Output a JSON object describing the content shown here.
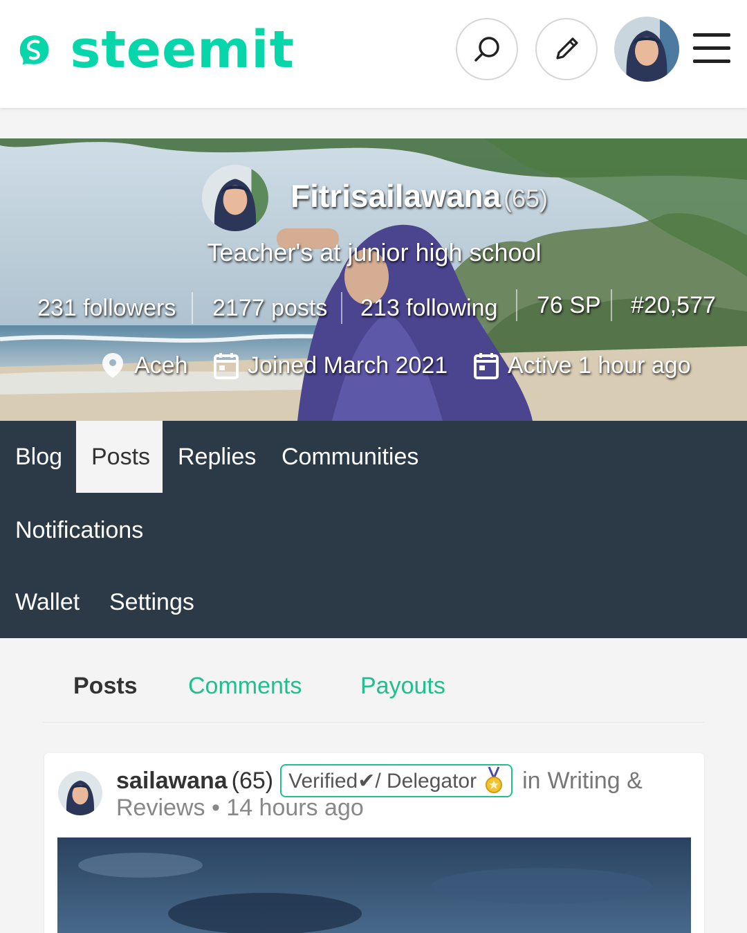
{
  "header": {
    "logo_text": "steemit",
    "brand_color": "#06d6a9",
    "icons": [
      "search-icon",
      "pencil-icon",
      "hamburger-menu-icon"
    ]
  },
  "profile": {
    "name": "Fitrisailawana",
    "reputation": "(65)",
    "about": "Teacher's at junior high school",
    "stats": {
      "followers": "231 followers",
      "posts": "2177 posts",
      "following": "213 following",
      "sp": "76 SP",
      "rank": "#20,577"
    },
    "location": "Aceh",
    "joined": "Joined March 2021",
    "active": "Active 1 hour ago"
  },
  "tabs": [
    {
      "label": "Blog"
    },
    {
      "label": "Posts",
      "active": true
    },
    {
      "label": "Replies"
    },
    {
      "label": "Communities"
    },
    {
      "label": "Notifications"
    },
    {
      "label": "Wallet"
    },
    {
      "label": "Settings"
    }
  ],
  "subtabs": [
    {
      "label": "Posts",
      "active": true
    },
    {
      "label": "Comments"
    },
    {
      "label": "Payouts"
    }
  ],
  "post": {
    "author": "sailawana",
    "reputation": "(65)",
    "badge": "Verified✔/ Delegator",
    "in_prefix": "in",
    "community_part1": "Writing &",
    "community_part2": "Reviews",
    "separator": "•",
    "time": "14 hours ago"
  },
  "colors": {
    "nav_bg": "#2c3a48",
    "link": "#1fbf8f",
    "page_bg": "#f4f4f4"
  }
}
